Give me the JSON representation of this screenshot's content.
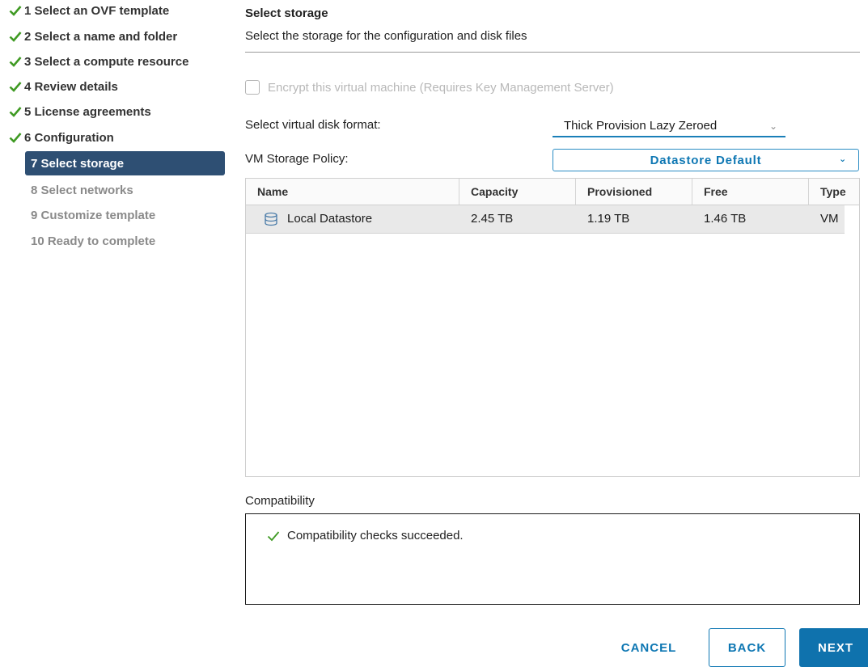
{
  "steps": [
    {
      "label": "1 Select an OVF template",
      "state": "done"
    },
    {
      "label": "2 Select a name and folder",
      "state": "done"
    },
    {
      "label": "3 Select a compute resource",
      "state": "done"
    },
    {
      "label": "4 Review details",
      "state": "done"
    },
    {
      "label": "5 License agreements",
      "state": "done"
    },
    {
      "label": "6 Configuration",
      "state": "done"
    },
    {
      "label": "7 Select storage",
      "state": "active"
    },
    {
      "label": "8 Select networks",
      "state": "pending"
    },
    {
      "label": "9 Customize template",
      "state": "pending"
    },
    {
      "label": "10 Ready to complete",
      "state": "pending"
    }
  ],
  "header": {
    "title": "Select storage",
    "subtitle": "Select the storage for the configuration and disk files"
  },
  "encrypt": {
    "label": "Encrypt this virtual machine (Requires Key Management Server)",
    "checked": false,
    "disabled": true
  },
  "disk_format": {
    "label": "Select virtual disk format:",
    "value": "Thick Provision Lazy Zeroed"
  },
  "storage_policy": {
    "label": "VM Storage Policy:",
    "value": "Datastore Default"
  },
  "table": {
    "columns": [
      "Name",
      "Capacity",
      "Provisioned",
      "Free",
      "Type"
    ],
    "rows": [
      {
        "name": "Local Datastore",
        "capacity": "2.45 TB",
        "provisioned": "1.19 TB",
        "free": "1.46 TB",
        "type": "VM"
      }
    ]
  },
  "compatibility": {
    "label": "Compatibility",
    "message": "Compatibility checks succeeded."
  },
  "buttons": {
    "cancel": "CANCEL",
    "back": "BACK",
    "next": "NEXT"
  },
  "colors": {
    "accent": "#0e77b3",
    "active_step_bg": "#2e4f73",
    "success_green": "#3f9a23"
  },
  "icons": {
    "step_done": "check-icon",
    "datastore": "database-icon",
    "compat_ok": "check-icon",
    "dropdown": "chevron-down-icon"
  }
}
